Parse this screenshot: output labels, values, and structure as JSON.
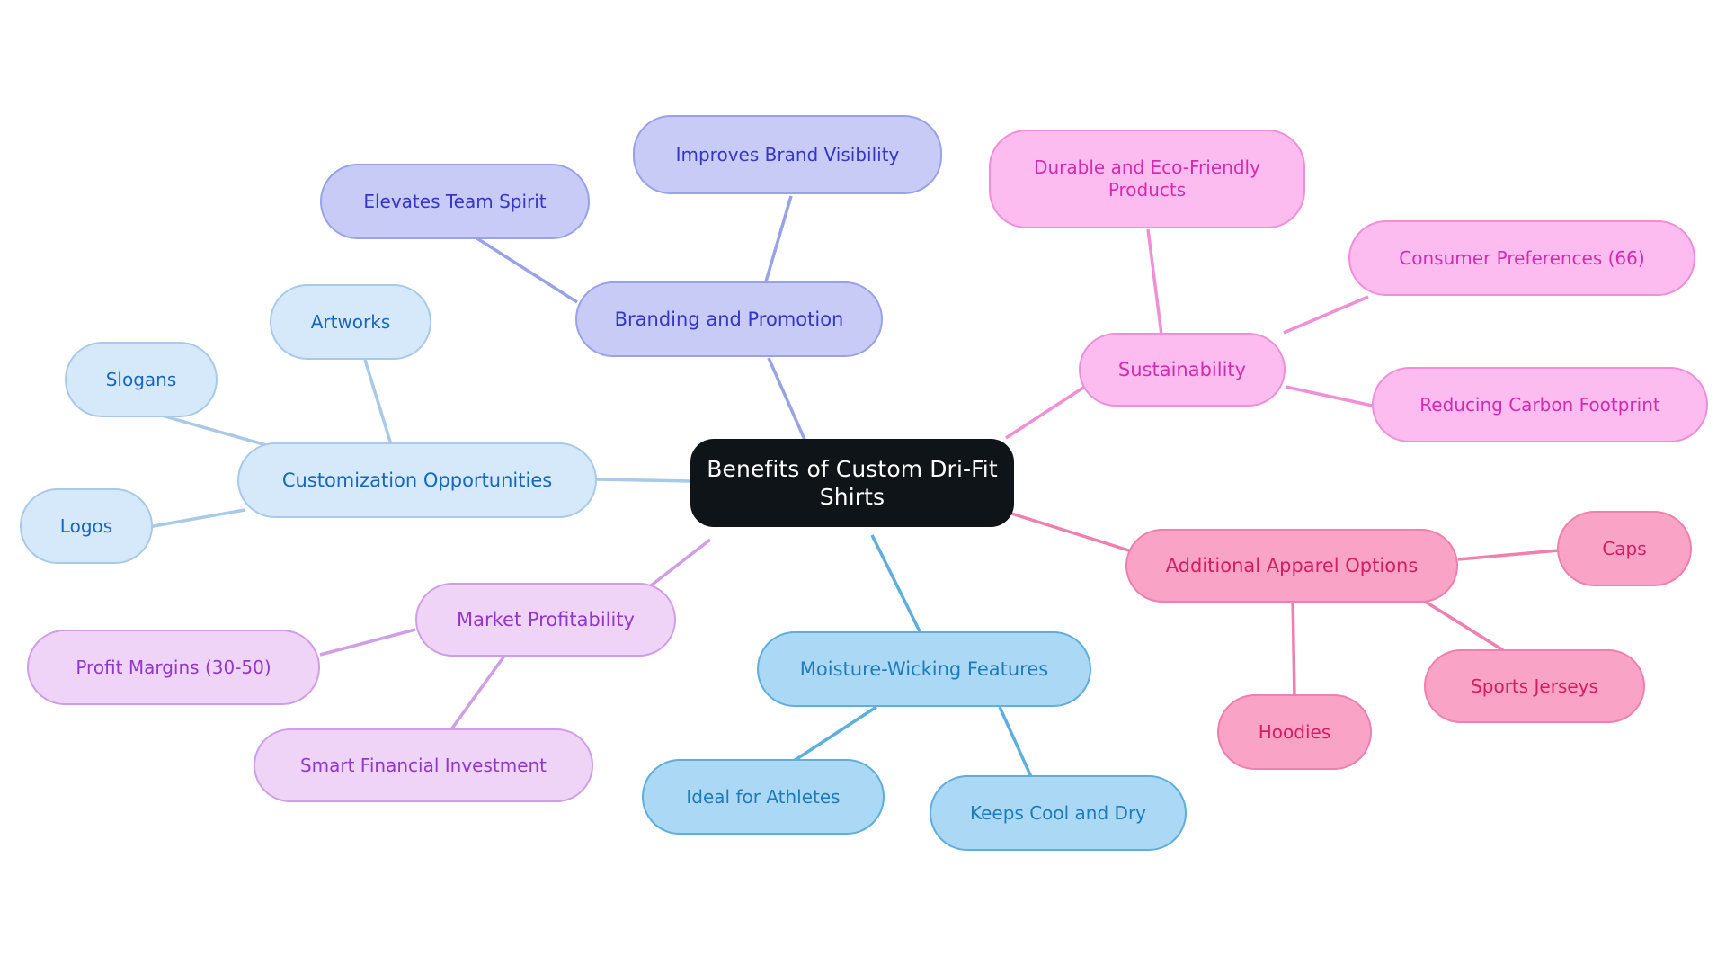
{
  "diagram": {
    "type": "mindmap",
    "title": "Benefits of Custom Dri-Fit Shirts",
    "background": "#ffffff"
  },
  "root": {
    "label": "Benefits of Custom Dri-Fit\nShirts",
    "fill": "#0f1419",
    "text_color": "#ffffff"
  },
  "palette": {
    "periwinkle_fill": "#c7cbf6",
    "periwinkle_border": "#9aa2e7",
    "periwinkle_text": "#3535c8",
    "lightblue_fill": "#d6e9fb",
    "lightblue_border": "#a8c9e8",
    "lightblue_text": "#1766c0",
    "skyblue_fill": "#abd8f4",
    "skyblue_border": "#5eaede",
    "skyblue_text": "#1d7cba",
    "violet_fill": "#efd4f8",
    "violet_border": "#cf9ee6",
    "violet_text": "#9038cc",
    "pink_fill": "#fcbcf0",
    "pink_border": "#f08ed8",
    "pink_text": "#d62bb0",
    "rose_fill": "#f9a3c7",
    "rose_border": "#ef7fae",
    "rose_text": "#d61c63"
  },
  "branches": [
    {
      "id": "branding",
      "label": "Branding and Promotion",
      "color": "periwinkle",
      "children": [
        {
          "id": "brand-visibility",
          "label": "Improves Brand Visibility"
        },
        {
          "id": "team-spirit",
          "label": "Elevates Team Spirit"
        }
      ]
    },
    {
      "id": "customization",
      "label": "Customization Opportunities",
      "color": "lightblue",
      "children": [
        {
          "id": "artworks",
          "label": "Artworks"
        },
        {
          "id": "slogans",
          "label": "Slogans"
        },
        {
          "id": "logos",
          "label": "Logos"
        }
      ]
    },
    {
      "id": "sustainability",
      "label": "Sustainability",
      "color": "pink",
      "children": [
        {
          "id": "durable-eco",
          "label": "Durable and Eco-Friendly\nProducts"
        },
        {
          "id": "consumer-preferences",
          "label": "Consumer Preferences (66)"
        },
        {
          "id": "carbon-footprint",
          "label": "Reducing Carbon Footprint"
        }
      ]
    },
    {
      "id": "apparel-options",
      "label": "Additional Apparel Options",
      "color": "rose",
      "children": [
        {
          "id": "caps",
          "label": "Caps"
        },
        {
          "id": "sports-jerseys",
          "label": "Sports Jerseys"
        },
        {
          "id": "hoodies",
          "label": "Hoodies"
        }
      ]
    },
    {
      "id": "moisture-wicking",
      "label": "Moisture-Wicking Features",
      "color": "skyblue",
      "children": [
        {
          "id": "ideal-athletes",
          "label": "Ideal for Athletes"
        },
        {
          "id": "keeps-cool",
          "label": "Keeps Cool and Dry"
        }
      ]
    },
    {
      "id": "market-profitability",
      "label": "Market Profitability",
      "color": "violet",
      "children": [
        {
          "id": "profit-margins",
          "label": "Profit Margins (30-50)"
        },
        {
          "id": "smart-investment",
          "label": "Smart Financial Investment"
        }
      ]
    }
  ]
}
